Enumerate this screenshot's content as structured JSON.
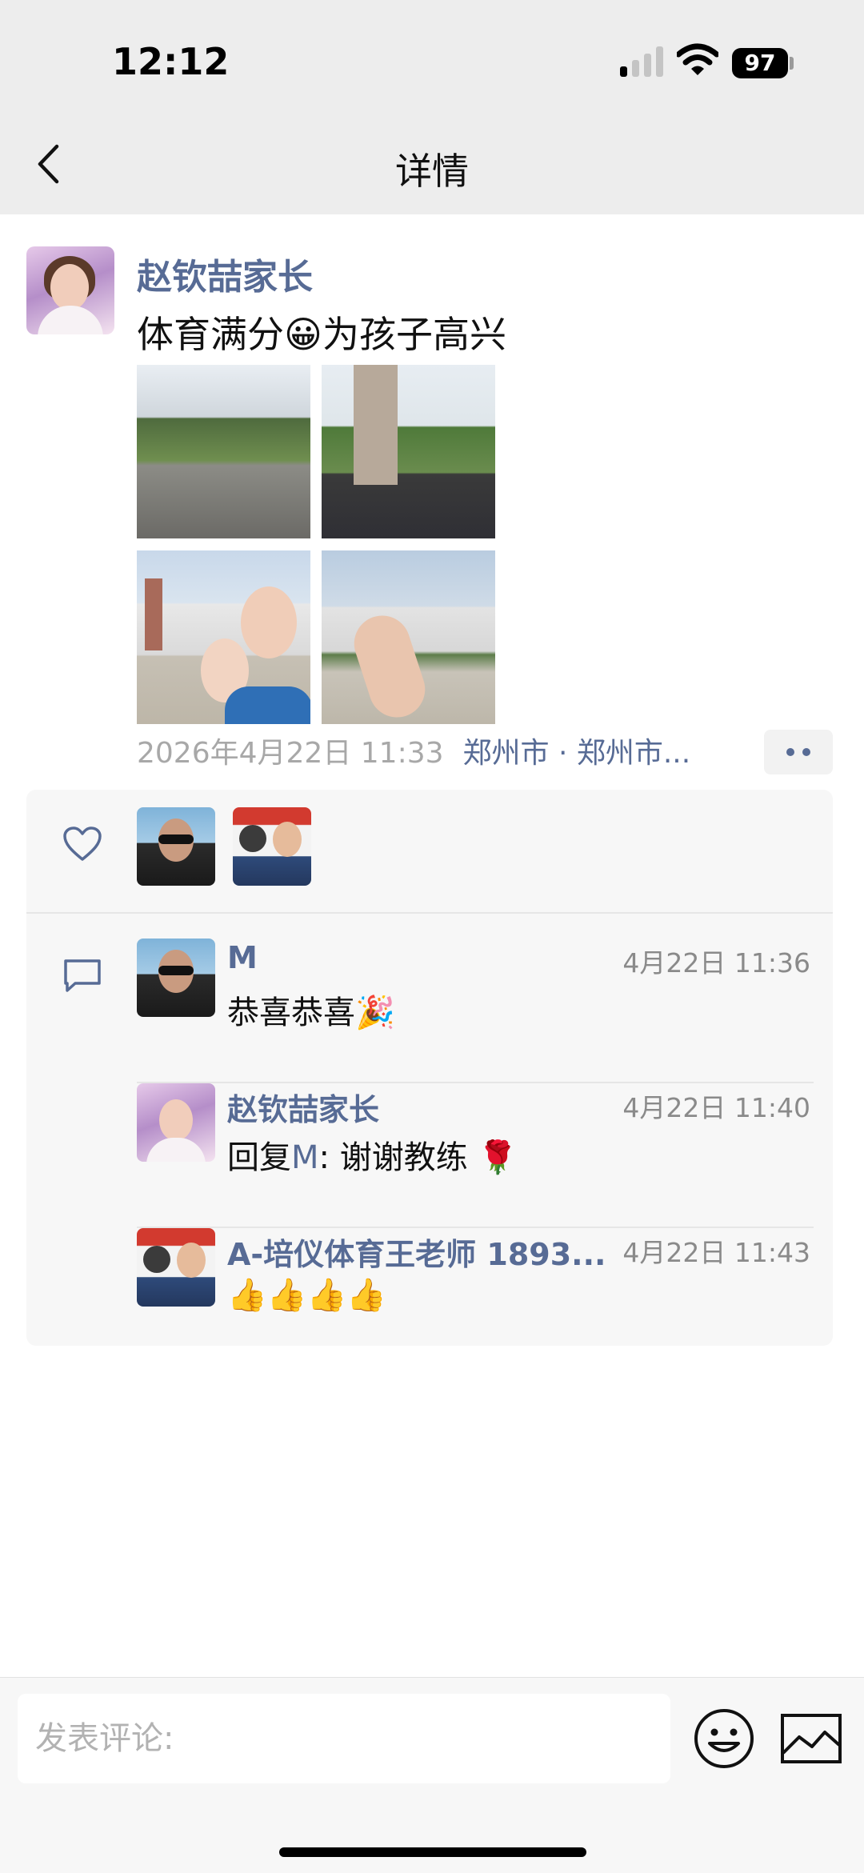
{
  "status_bar": {
    "time": "12:12",
    "battery": "97"
  },
  "nav": {
    "title": "详情",
    "back_icon": "chevron-left-icon"
  },
  "post": {
    "author": "赵钦喆家长",
    "text": "体育满分😀为孩子高兴",
    "photos": [
      "photo-1",
      "photo-2",
      "photo-3",
      "photo-4"
    ],
    "time": "2026年4月22日 11:33",
    "location": "郑州市 · 郑州市..."
  },
  "likes": {
    "icon": "heart-icon",
    "users": [
      "M",
      "A-培仪体育王老师"
    ]
  },
  "comments": {
    "icon": "comment-icon",
    "items": [
      {
        "name": "M",
        "time": "4月22日 11:36",
        "text": "恭喜恭喜🎉"
      },
      {
        "name": "赵钦喆家长",
        "time": "4月22日 11:40",
        "reply_prefix": "回复",
        "reply_target": "M",
        "text": ": 谢谢教练 🌹"
      },
      {
        "name": "A-培仪体育王老师 1893...",
        "time": "4月22日 11:43",
        "text": "👍👍👍👍"
      }
    ]
  },
  "input": {
    "placeholder": "发表评论:"
  },
  "colors": {
    "link_blue": "#576b95",
    "nav_bg": "#ededed",
    "panel_bg": "#f7f7f7"
  }
}
